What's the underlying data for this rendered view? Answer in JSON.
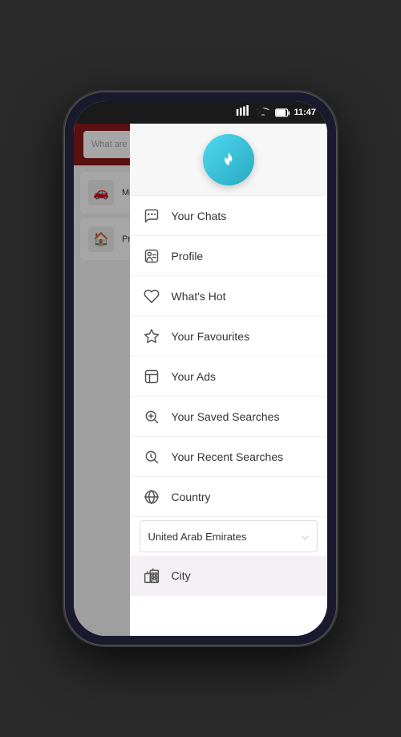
{
  "phone": {
    "time": "11:47"
  },
  "app": {
    "search_placeholder": "What are you looking for?",
    "categories": [
      {
        "icon": "🚗",
        "label": "Motors"
      },
      {
        "icon": "🏠",
        "label": "Property Rentals"
      }
    ]
  },
  "drawer": {
    "logo_alt": "Dubizzle Logo",
    "menu_items": [
      {
        "id": "chats",
        "label": "Your Chats",
        "icon": "chat"
      },
      {
        "id": "profile",
        "label": "Profile",
        "icon": "profile"
      },
      {
        "id": "whats-hot",
        "label": "What's Hot",
        "icon": "heart"
      },
      {
        "id": "favourites",
        "label": "Your Favourites",
        "icon": "star"
      },
      {
        "id": "ads",
        "label": "Your Ads",
        "icon": "ads"
      },
      {
        "id": "saved-searches",
        "label": "Your Saved Searches",
        "icon": "saved"
      },
      {
        "id": "recent-searches",
        "label": "Your Recent Searches",
        "icon": "recent"
      },
      {
        "id": "country",
        "label": "Country",
        "icon": "globe"
      }
    ],
    "country_selected": "United Arab Emirates",
    "city_label": "City"
  }
}
